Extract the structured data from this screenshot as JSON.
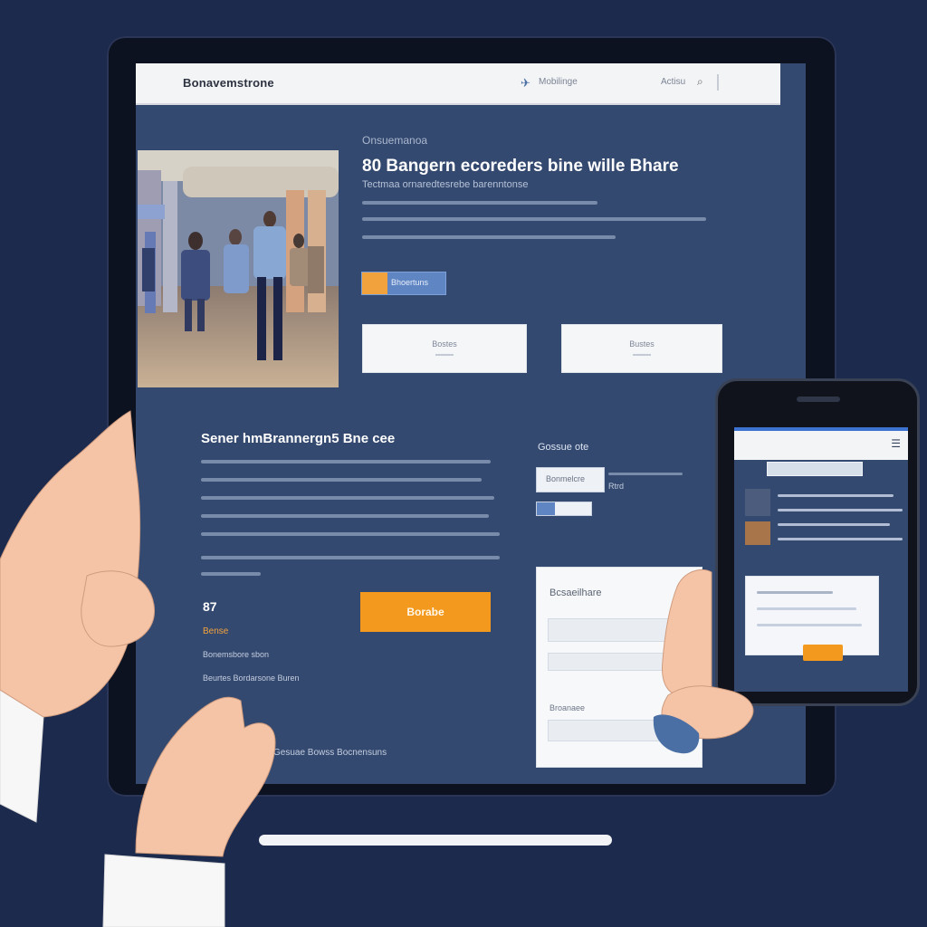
{
  "colors": {
    "background": "#1c2a4d",
    "screen": "#34496f",
    "accent": "#f39a1e",
    "primary": "#5f86c3",
    "surface": "#f5f6f8"
  },
  "tablet": {
    "topbar": {
      "brand": "Bonavemstrone",
      "links": [
        "Mobilinge",
        "Actisu"
      ],
      "menu_icon": "menu-icon",
      "search_icon": "search-icon"
    },
    "hero": {
      "eyebrow": "Onsuemanoa",
      "title": "80 Bangern ecoreders bine wille Bhare",
      "subtitle": "Tectmaa ornaredtesrebe barenntonse",
      "cta": "Bhoertuns",
      "cards": [
        "Bostes",
        "Bustes"
      ]
    },
    "details": {
      "title": "Sener hmBrannergn5 Bne cee",
      "price": "87",
      "price_note": "Bense",
      "meta_1": "Bonemsbore sbon",
      "meta_2": "Beurtes Bordarsone Buren",
      "buy_label": "Borabe",
      "footer": "Gesuae Bowss Bocnensuns"
    },
    "side": {
      "heading": "Gossue ote",
      "chip_1": "Bonmelcre",
      "chip_2": "Rtrd"
    },
    "form": {
      "title": "Bcsaeilhare",
      "label": "Broanaee"
    }
  },
  "phone": {
    "menu_icon": "menu-icon"
  }
}
